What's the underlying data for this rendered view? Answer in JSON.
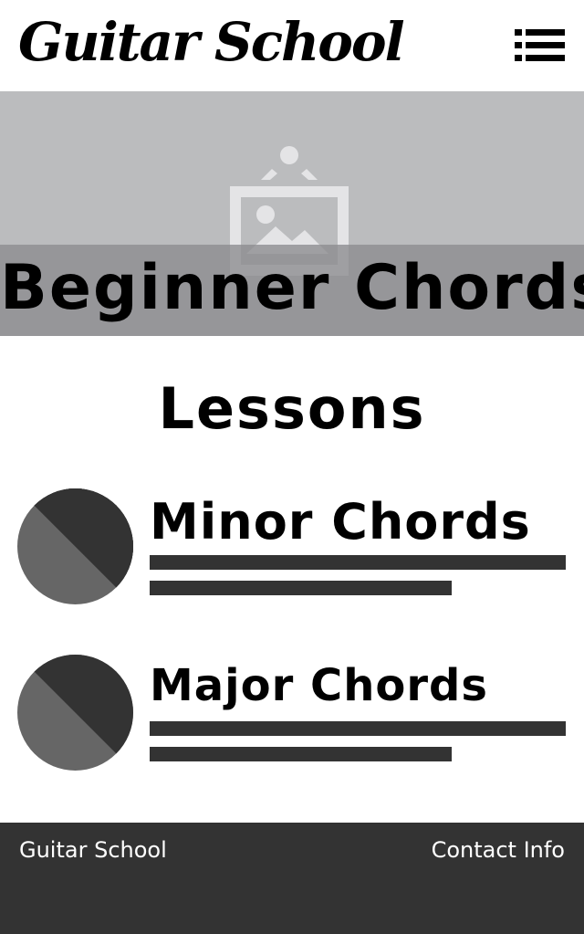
{
  "header": {
    "logo_text": "Guitar School",
    "menu_icon": "list-menu-icon"
  },
  "hero": {
    "image_icon": "image-placeholder-icon",
    "title": "Beginner Chords"
  },
  "lessons": {
    "heading": "Lessons",
    "items": [
      {
        "title": "Minor Chords",
        "thumbnail_icon": "thumbnail-placeholder-icon"
      },
      {
        "title": "Major Chords",
        "thumbnail_icon": "thumbnail-placeholder-icon"
      }
    ]
  },
  "footer": {
    "brand": "Guitar School",
    "contact": "Contact Info"
  },
  "colors": {
    "hero_background": "#bbbcbe",
    "hero_band": "#8c8c8e",
    "text_lines": "#333333",
    "footer_background": "#333333",
    "thumb_dark": "#333333",
    "thumb_light": "#666666"
  }
}
